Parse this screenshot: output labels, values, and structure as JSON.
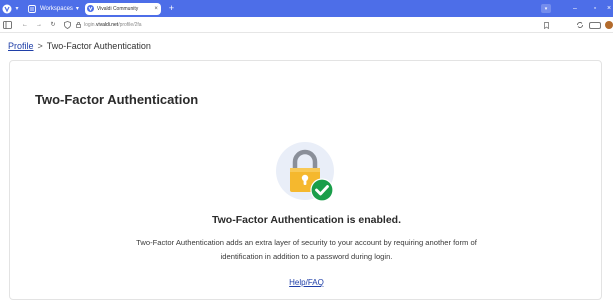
{
  "browser": {
    "workspaces_label": "Workspaces",
    "tab_title": "Vivaldi Community",
    "url_prefix": "login.",
    "url_host": "vivaldi.net",
    "url_path": "/profile/2fa",
    "accent": "#4d6ee8"
  },
  "breadcrumb": {
    "root": "Profile",
    "separator": ">",
    "current": "Two-Factor Authentication"
  },
  "card": {
    "title": "Two-Factor Authentication",
    "status_icon": "lock-with-check-icon",
    "status_heading": "Two-Factor Authentication is enabled.",
    "status_description": "Two-Factor Authentication adds an extra layer of security to your account by requiring another form of identification in addition to a password during login.",
    "help_link": "Help/FAQ"
  },
  "colors": {
    "link": "#1f3fa8",
    "lock_body": "#f5b82e",
    "check_badge": "#1a9e4a",
    "icon_circle": "#e9eef8"
  }
}
